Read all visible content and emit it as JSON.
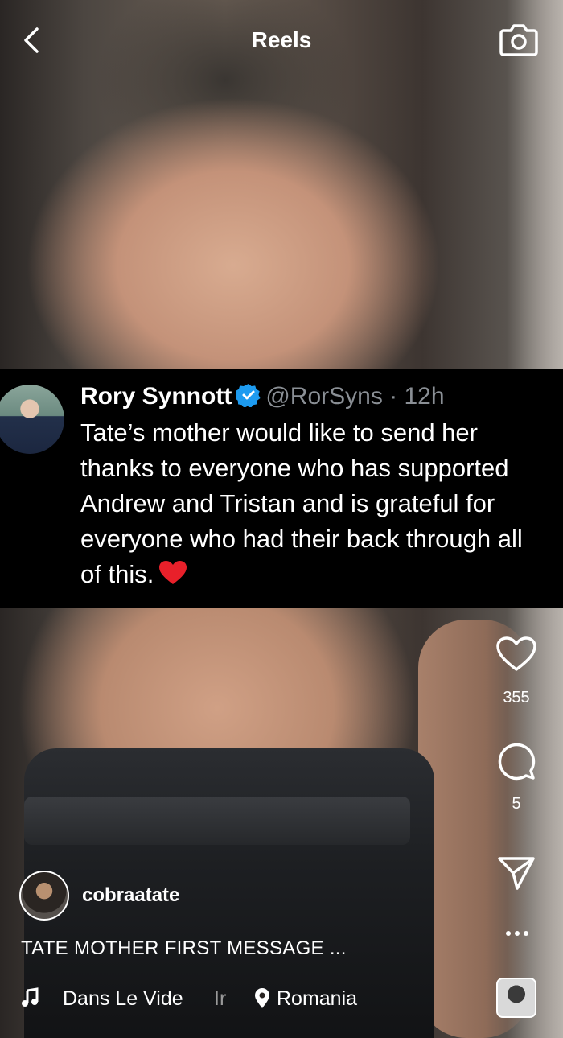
{
  "header": {
    "title": "Reels"
  },
  "tweet": {
    "name": "Rory Synnott",
    "handle_time": "@RorSyns · 12h",
    "text": "Tate’s mother would like to send her\nthanks to everyone who has supported\nAndrew and Tristan and is grateful for\neveryone who had their back through all\nof this."
  },
  "actions": {
    "likes": "355",
    "comments": "5"
  },
  "post": {
    "username": "cobraatate",
    "caption": "TATE MOTHER FIRST MESSAGE ...",
    "audio": "Dans Le Vide",
    "audio_overflow": "Ir",
    "location": "Romania"
  },
  "colors": {
    "tweet_bg": "#000000",
    "verified_blue": "#1d9bf0",
    "heart_red": "#e8202a",
    "handle_gray": "#8a8f95"
  }
}
